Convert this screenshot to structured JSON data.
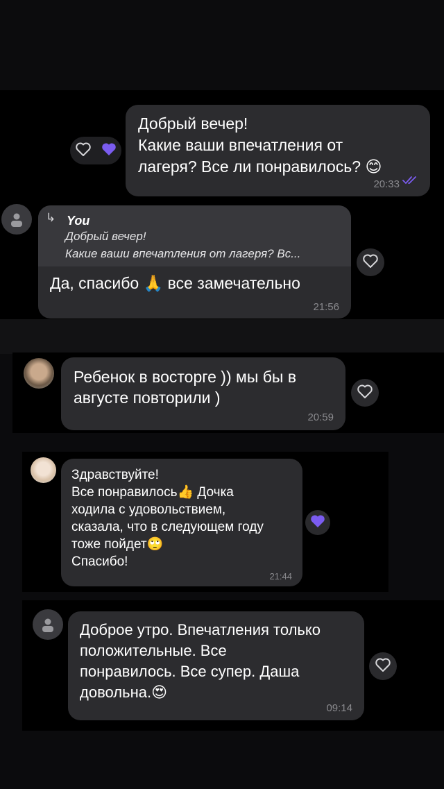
{
  "messages": [
    {
      "id": "m1",
      "direction": "outgoing",
      "text": "Добрый вечер!\nКакие ваши впечатления от\nлагеря? Все ли понравилось?",
      "emoji": "😊",
      "time": "20:33",
      "read_status": "double-check-icon",
      "reactions": [
        "heart-outline-icon",
        "heart-filled-icon"
      ]
    },
    {
      "id": "m2",
      "direction": "incoming",
      "reply": {
        "author": "You",
        "line1": "Добрый вечер!",
        "line2": "Какие ваши впечатления от лагеря? Вс..."
      },
      "text_before": "Да, спасибо",
      "emoji": "🙏",
      "text_after": "все замечательно",
      "time": "21:56"
    },
    {
      "id": "m3",
      "direction": "incoming",
      "text": "Ребенок в восторге )) мы бы в\nавгусте повторили )",
      "time": "20:59"
    },
    {
      "id": "m4",
      "direction": "incoming",
      "line1": "Здравствуйте!",
      "line2": "Все понравилось",
      "emoji_thumbs": "👍",
      "line2_rest": " Дочка",
      "line3": "ходила с удовольствием,",
      "line4": "сказала, что в следующем году",
      "line5": "тоже пойдет",
      "emoji_face": "🙄",
      "line6": "Спасибо!",
      "time": "21:44",
      "reaction": "heart-filled-icon"
    },
    {
      "id": "m5",
      "direction": "incoming",
      "text": "Доброе утро. Впечатления только\nположительные. Все\nпонравилось. Все супер. Даша\nдовольна.",
      "emoji": "😍",
      "time": "09:14"
    }
  ],
  "colors": {
    "accent": "#7b5cf0",
    "bubble": "#2c2c2f",
    "time": "#8a8a8e"
  }
}
